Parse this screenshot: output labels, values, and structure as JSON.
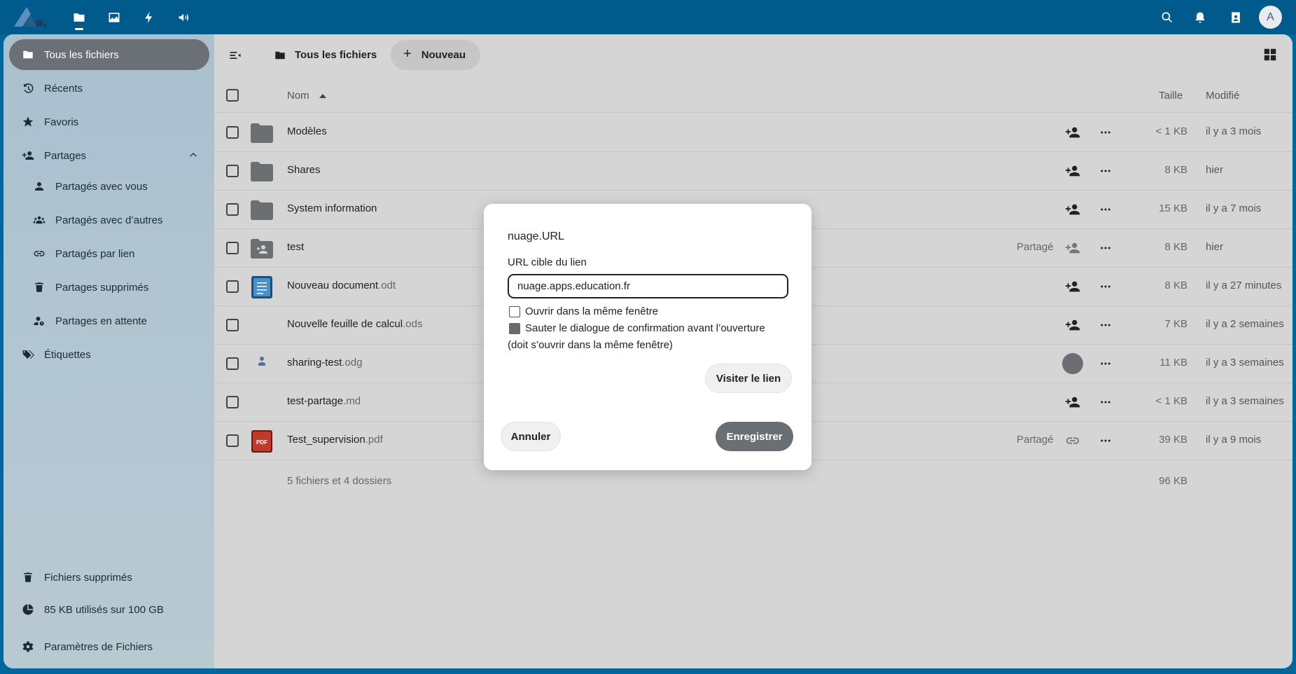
{
  "topbar": {
    "apps": [
      "files-icon",
      "photos-icon",
      "activity-icon",
      "announcements-icon"
    ],
    "right_icons": [
      "search-icon",
      "notifications-icon",
      "contacts-icon"
    ],
    "avatar_letter": "A"
  },
  "sidebar": {
    "items": [
      {
        "label": "Tous les fichiers",
        "icon": "folder-icon",
        "active": true
      },
      {
        "label": "Récents",
        "icon": "history-icon"
      },
      {
        "label": "Favoris",
        "icon": "star-icon"
      },
      {
        "label": "Partages",
        "icon": "share-icon",
        "expanded": true
      },
      {
        "label": "Partagés avec vous",
        "icon": "user-icon"
      },
      {
        "label": "Partagés avec d’autres",
        "icon": "users-icon"
      },
      {
        "label": "Partagés par lien",
        "icon": "link-icon"
      },
      {
        "label": "Partages supprimés",
        "icon": "trash-icon"
      },
      {
        "label": "Partages en attente",
        "icon": "pending-user-icon"
      },
      {
        "label": "Étiquettes",
        "icon": "tags-icon"
      }
    ],
    "footer": {
      "trash": "Fichiers supprimés",
      "quota": "85 KB utilisés sur 100 GB",
      "settings": "Paramètres de Fichiers"
    }
  },
  "toolbar": {
    "breadcrumb": "Tous les fichiers",
    "new_label": "Nouveau"
  },
  "table": {
    "headers": {
      "name": "Nom",
      "size": "Taille",
      "modified": "Modifié"
    },
    "rows": [
      {
        "name": "Modèles",
        "ext": "",
        "type": "folder",
        "shared_label": "",
        "size": "< 1 KB",
        "modified": "il y a 3 mois"
      },
      {
        "name": "Shares",
        "ext": "",
        "type": "folder",
        "shared_label": "",
        "size": "8 KB",
        "modified": "hier"
      },
      {
        "name": "System information",
        "ext": "",
        "type": "folder",
        "shared_label": "",
        "size": "15 KB",
        "modified": "il y a 7 mois"
      },
      {
        "name": "test",
        "ext": "",
        "type": "shared-folder",
        "shared_label": "Partagé",
        "size": "8 KB",
        "modified": "hier"
      },
      {
        "name": "Nouveau document",
        "ext": ".odt",
        "type": "odt",
        "shared_label": "",
        "size": "8 KB",
        "modified": "il y a 27 minutes"
      },
      {
        "name": "Nouvelle feuille de calcul",
        "ext": ".ods",
        "type": "blank",
        "shared_label": "",
        "size": "7 KB",
        "modified": "il y a 2 semaines"
      },
      {
        "name": "sharing-test",
        "ext": ".odg",
        "type": "odg",
        "shared_label": "",
        "size": "11 KB",
        "modified": "il y a 3 semaines"
      },
      {
        "name": "test-partage",
        "ext": ".md",
        "type": "blank",
        "shared_label": "",
        "size": "< 1 KB",
        "modified": "il y a 3 semaines"
      },
      {
        "name": "Test_supervision",
        "ext": ".pdf",
        "type": "pdf",
        "shared_label": "Partagé",
        "size": "39 KB",
        "modified": "il y a 9 mois"
      }
    ],
    "summary": "5 fichiers et 4 dossiers",
    "total_size": "96 KB"
  },
  "dialog": {
    "title": "nuage.URL",
    "field_label": "URL cible du lien",
    "url_value": "nuage.apps.education.fr",
    "check_same_window": "Ouvrir dans la même fenêtre",
    "check_skip_confirm": "Sauter le dialogue de confirmation avant l’ouverture",
    "note": "(doit s’ouvrir dans la même fenêtre)",
    "visit_label": "Visiter le lien",
    "cancel_label": "Annuler",
    "save_label": "Enregistrer"
  }
}
